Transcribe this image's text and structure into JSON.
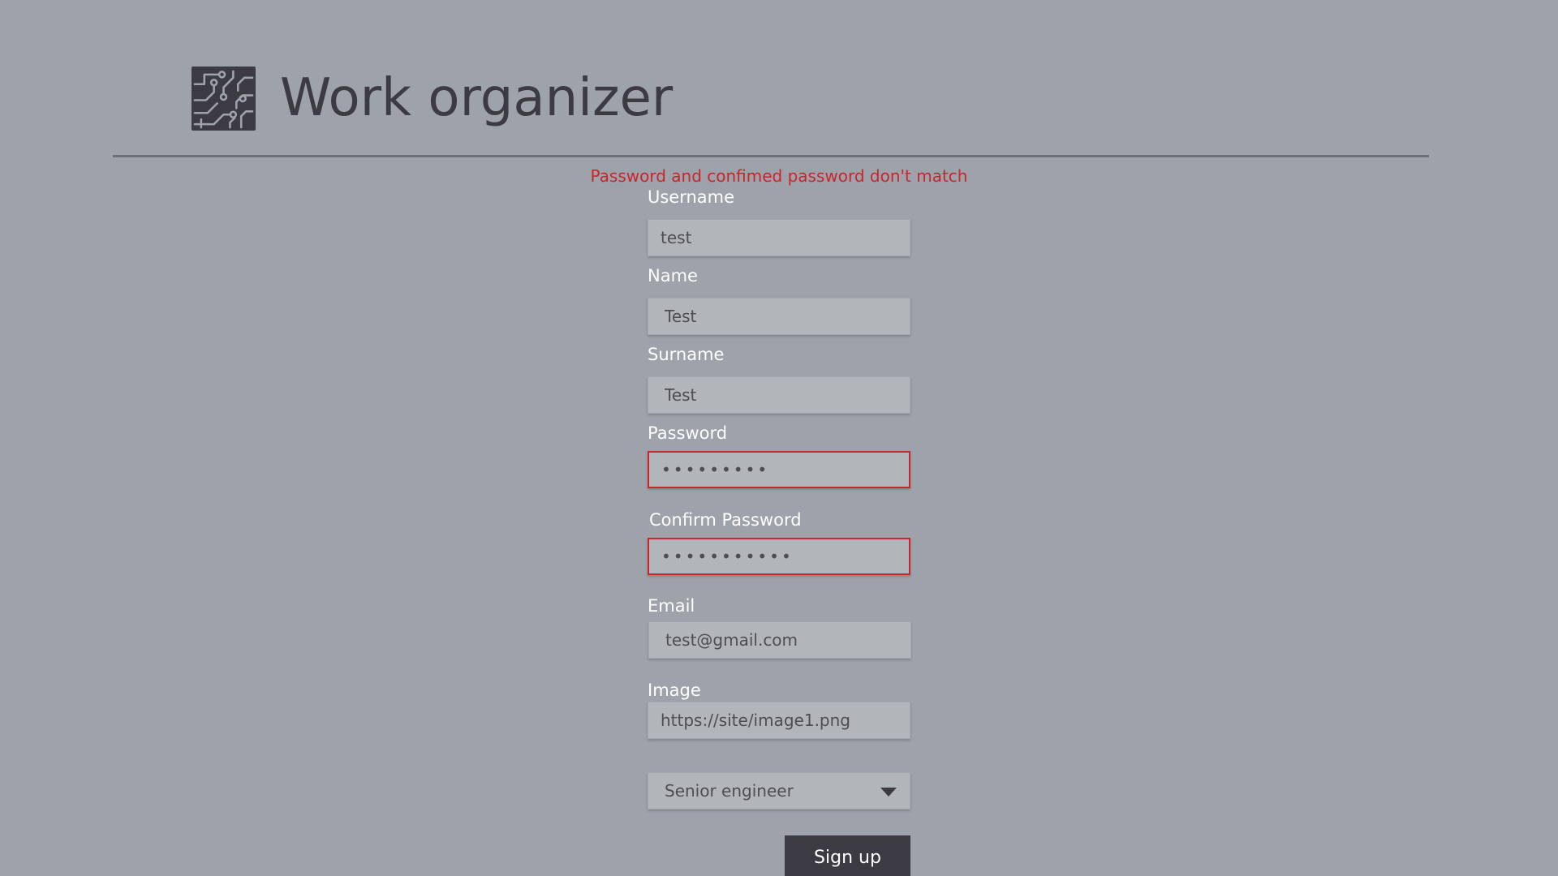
{
  "app": {
    "title": "Work organizer",
    "logo_icon": "circuit-board-icon"
  },
  "form": {
    "error_message": "Password and confimed password don't match",
    "username": {
      "label": "Username",
      "value": "test"
    },
    "name": {
      "label": "Name",
      "value": "Test"
    },
    "surname": {
      "label": "Surname",
      "value": "Test"
    },
    "password": {
      "label": "Password",
      "value": "•••••••••"
    },
    "confirm_password": {
      "label": "Confirm Password",
      "value": "•••••••••••"
    },
    "email": {
      "label": "Email",
      "value": "test@gmail.com"
    },
    "image": {
      "label": "Image",
      "value": "https://site/image1.png"
    },
    "position": {
      "selected": "Senior engineer"
    },
    "submit_label": "Sign up"
  },
  "colors": {
    "background": "#9ea2aa",
    "dark": "#3c3a43",
    "error": "#c8262b",
    "input_bg": "#b2b5ba"
  }
}
